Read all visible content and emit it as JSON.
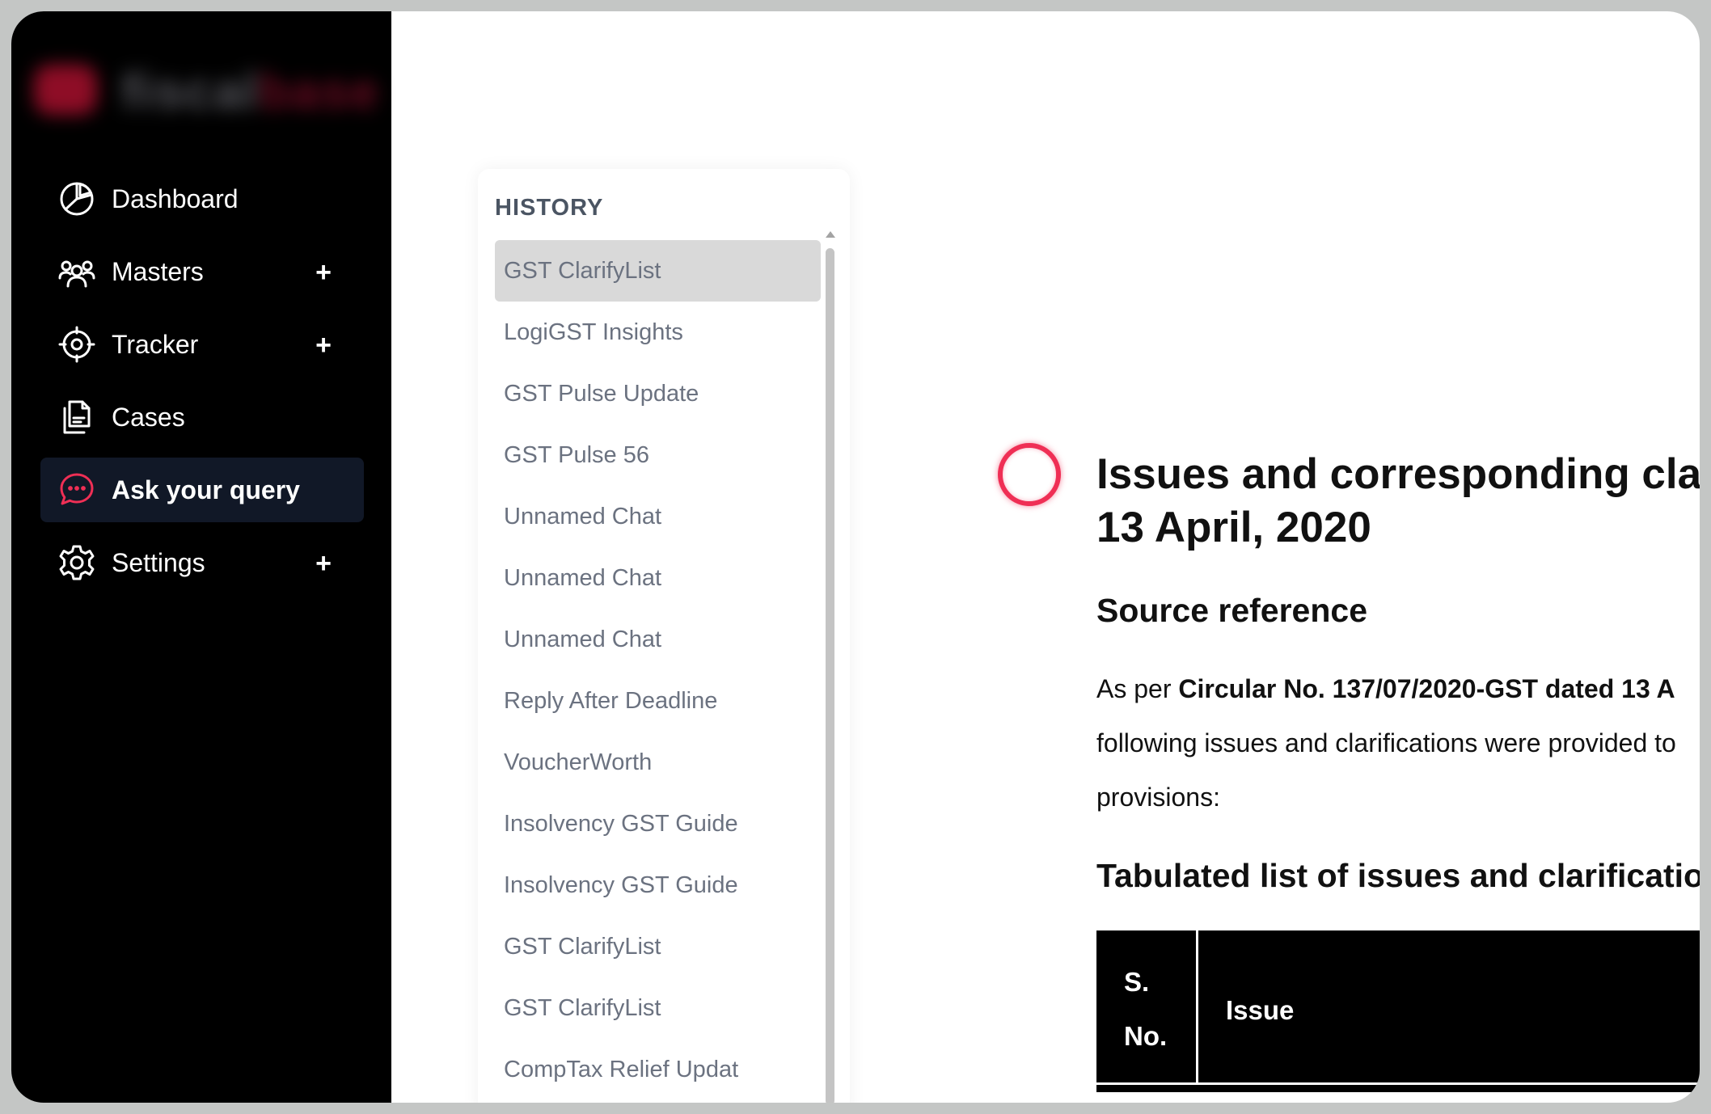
{
  "sidebar": {
    "logo_text": "fiscal",
    "logo_text_accent": "base",
    "items": [
      {
        "label": "Dashboard",
        "icon": "pie-chart-icon",
        "expandable": false,
        "active": false
      },
      {
        "label": "Masters",
        "icon": "users-icon",
        "expandable": true,
        "active": false
      },
      {
        "label": "Tracker",
        "icon": "crosshair-icon",
        "expandable": true,
        "active": false
      },
      {
        "label": "Cases",
        "icon": "document-icon",
        "expandable": false,
        "active": false
      },
      {
        "label": "Ask your query",
        "icon": "chat-icon",
        "expandable": false,
        "active": true
      },
      {
        "label": "Settings",
        "icon": "gear-icon",
        "expandable": true,
        "active": false
      }
    ],
    "expand_symbol": "+"
  },
  "history": {
    "title": "HISTORY",
    "items": [
      "GST ClarifyList",
      "LogiGST Insights",
      "GST Pulse Update",
      "GST Pulse 56",
      "Unnamed Chat",
      "Unnamed Chat",
      "Unnamed Chat",
      "Reply After Deadline",
      "VoucherWorth",
      "Insolvency GST Guide",
      "Insolvency GST Guide",
      "GST ClarifyList",
      "GST ClarifyList",
      "CompTax Relief Updat"
    ],
    "selected_index": 0
  },
  "document": {
    "title_line1": "Issues and corresponding cla",
    "title_line2": "13 April, 2020",
    "source_heading": "Source reference",
    "para_prefix": "As per ",
    "para_bold": "Circular No. 137/07/2020-GST dated 13 A",
    "para_line2": "following issues and clarifications were provided to",
    "para_line3": "provisions:",
    "table_heading": "Tabulated list of issues and clarificatio",
    "table": {
      "col1_line1": "S.",
      "col1_line2": "No.",
      "col2": "Issue"
    }
  },
  "colors": {
    "sidebar_bg": "#000000",
    "active_item_bg": "#111827",
    "accent": "#ef2f55",
    "history_selected_bg": "#d9d9d9",
    "history_text": "#6b7280"
  }
}
